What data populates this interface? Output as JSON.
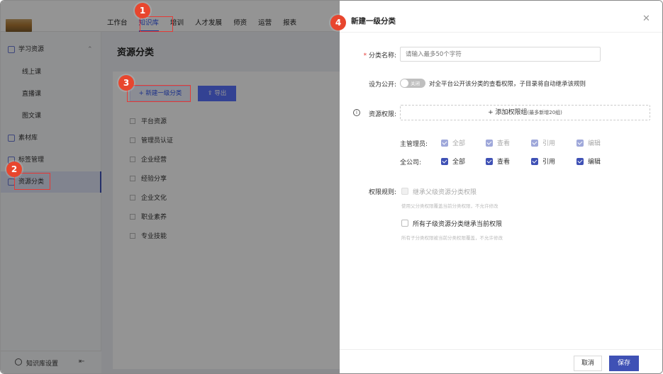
{
  "nav": {
    "items": [
      "工作台",
      "知识库",
      "培训",
      "人才发展",
      "师资",
      "运营",
      "报表"
    ],
    "active_index": 1
  },
  "sidebar": {
    "items": [
      {
        "label": "学习资源",
        "type": "group"
      },
      {
        "label": "线上课",
        "type": "sub"
      },
      {
        "label": "直播课",
        "type": "sub"
      },
      {
        "label": "图文课",
        "type": "sub"
      },
      {
        "label": "素材库",
        "type": "group"
      },
      {
        "label": "标签管理",
        "type": "group"
      },
      {
        "label": "资源分类",
        "type": "group",
        "active": true
      }
    ],
    "footer_label": "知识库设置"
  },
  "main": {
    "title": "资源分类",
    "new_button": "新建一级分类",
    "export_button": "导出",
    "categories": [
      "平台资源",
      "管理员认证",
      "企业经营",
      "经验分享",
      "企业文化",
      "职业素养",
      "专业技能"
    ]
  },
  "drawer": {
    "title": "新建一级分类",
    "name_label": "分类名称:",
    "name_placeholder": "请输入最多50个字符",
    "public_label": "设为公开:",
    "toggle_text": "关闭",
    "public_hint": "对全平台公开该分类的查看权限，子目录将自动继承该规则",
    "perm_label": "资源权限:",
    "add_group": "添加权限组",
    "add_group_note": "(最多新增20组)",
    "rows": [
      {
        "label": "主管理员:",
        "options": [
          "全部",
          "查看",
          "引用",
          "编辑"
        ],
        "disabled": true
      },
      {
        "label": "全公司:",
        "options": [
          "全部",
          "查看",
          "引用",
          "编辑"
        ],
        "disabled": false
      }
    ],
    "rule_label": "权限规则:",
    "rule1": "继承父级资源分类权限",
    "rule1_hint": "使用父分类权限覆盖当前分类权限，不允许修改",
    "rule2": "所有子级资源分类继承当前权限",
    "rule2_hint": "所有子分类权限被当前分类权限覆盖，不允许修改",
    "cancel": "取消",
    "save": "保存"
  },
  "annotations": [
    "1",
    "2",
    "3",
    "4"
  ]
}
